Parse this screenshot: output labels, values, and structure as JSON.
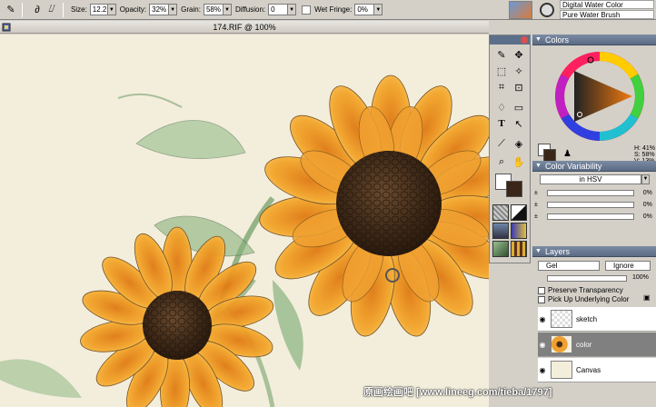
{
  "propbar": {
    "size_label": "Size:",
    "size_value": "12.2",
    "opacity_label": "Opacity:",
    "opacity_value": "32%",
    "grain_label": "Grain:",
    "grain_value": "58%",
    "diffusion_label": "Diffusion:",
    "diffusion_value": "0",
    "wetfringe_label": "Wet Fringe:",
    "wetfringe_value": "0%"
  },
  "brush": {
    "category": "Digital Water Color",
    "variant": "Pure Water Brush"
  },
  "document": {
    "title": "174.RIF @ 100%"
  },
  "colors_panel": {
    "title": "Colors",
    "h": "H: 41%",
    "s": "S: 58%",
    "v": "V: 13%",
    "main_color": "#3a2618",
    "secondary_color": "#ffffff"
  },
  "variability_panel": {
    "title": "Color Variability",
    "mode": "in HSV",
    "rows": [
      {
        "letter": "±",
        "value": "0%"
      },
      {
        "letter": "±",
        "value": "0%"
      },
      {
        "letter": "±",
        "value": "0%"
      }
    ]
  },
  "layers_panel": {
    "title": "Layers",
    "composite_method": "Gel",
    "composite_depth": "Ignore",
    "opacity": "100%",
    "preserve_transparency": "Preserve Transparency",
    "pick_up_underlying": "Pick Up Underlying Color",
    "layers": [
      {
        "name": "sketch",
        "selected": false
      },
      {
        "name": "color",
        "selected": true
      },
      {
        "name": "Canvas",
        "selected": false
      }
    ]
  },
  "watermark": "原画绘画吧 [www.lineeg.com/tieba/1797]",
  "icons": [
    "brush-icon",
    "stroke-icon",
    "pen-tool-icon",
    "move-icon",
    "rect-select-icon",
    "magic-wand-icon",
    "crop-icon",
    "transform-icon",
    "pen-icon",
    "rectangle-icon",
    "text-icon",
    "selector-icon",
    "dropper-icon",
    "bucket-icon",
    "magnifier-icon",
    "grabber-icon"
  ]
}
